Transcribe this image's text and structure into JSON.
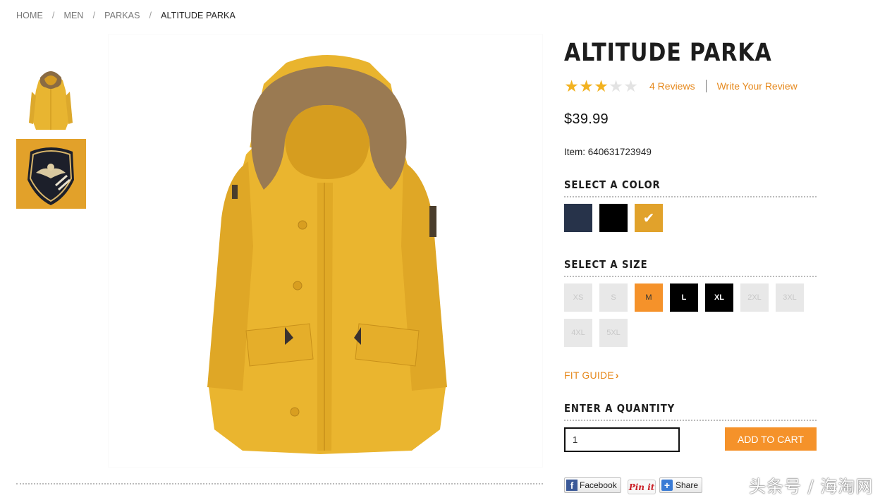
{
  "breadcrumb": {
    "items": [
      "HOME",
      "MEN",
      "PARKAS"
    ],
    "separator": "/",
    "current": "ALTITUDE PARKA"
  },
  "thumbnails": [
    {
      "name": "parka-front",
      "color": "#e8b531"
    },
    {
      "name": "patch-closeup",
      "color": "#e2a12a"
    }
  ],
  "main_image": {
    "subject": "yellow parka with fur hood",
    "color": "#e9b42e"
  },
  "product": {
    "title": "ALTITUDE PARKA",
    "rating": 3,
    "rating_max": 5,
    "reviews_label": "4 Reviews",
    "write_review_label": "Write Your Review",
    "price": "$39.99",
    "item_label": "Item:",
    "item_number": "640631723949"
  },
  "color_section": {
    "title": "SELECT A COLOR",
    "swatches": [
      {
        "name": "navy",
        "hex": "#27334a",
        "selected": false
      },
      {
        "name": "black",
        "hex": "#000000",
        "selected": false
      },
      {
        "name": "gold",
        "hex": "#e1a22b",
        "selected": true
      }
    ]
  },
  "size_section": {
    "title": "SELECT A SIZE",
    "sizes": [
      {
        "label": "XS",
        "state": "unavailable"
      },
      {
        "label": "S",
        "state": "unavailable"
      },
      {
        "label": "M",
        "state": "selected"
      },
      {
        "label": "L",
        "state": "available"
      },
      {
        "label": "XL",
        "state": "available"
      },
      {
        "label": "2XL",
        "state": "unavailable"
      },
      {
        "label": "3XL",
        "state": "unavailable"
      },
      {
        "label": "4XL",
        "state": "unavailable"
      },
      {
        "label": "5XL",
        "state": "unavailable"
      }
    ]
  },
  "fit_guide": {
    "label": "FIT GUIDE",
    "chevron": "›"
  },
  "quantity_section": {
    "title": "ENTER A QUANTITY",
    "value": "1",
    "add_to_cart_label": "ADD TO CART"
  },
  "social": {
    "facebook_label": "Facebook",
    "facebook_icon": "f",
    "pinterest_label": "Pin it",
    "share_label": "Share",
    "share_icon": "+"
  },
  "watermark": "头条号 / 海淘网",
  "colors": {
    "accent": "#e68a1f",
    "button": "#f5922a",
    "star": "#f2b220"
  }
}
